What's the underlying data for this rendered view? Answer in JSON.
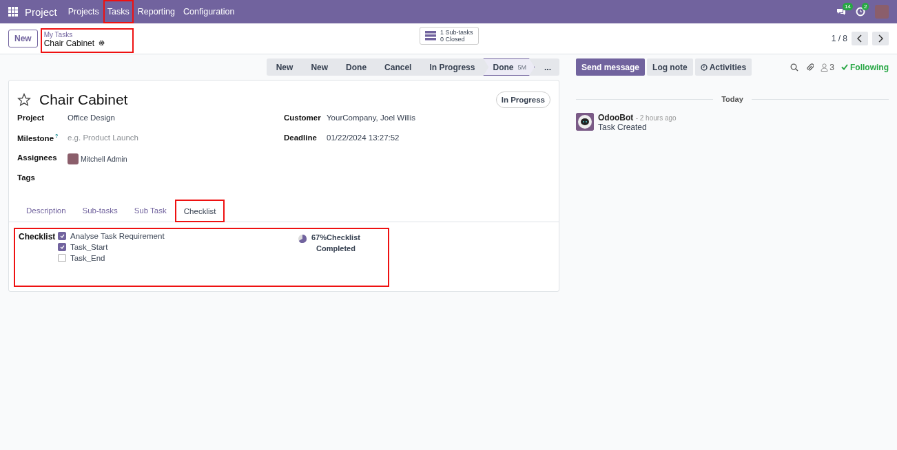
{
  "navbar": {
    "app": "Project",
    "menu": [
      {
        "label": "Projects",
        "highlighted": false
      },
      {
        "label": "Tasks",
        "highlighted": true
      },
      {
        "label": "Reporting",
        "highlighted": false
      },
      {
        "label": "Configuration",
        "highlighted": false
      }
    ],
    "messages_badge": "14",
    "activities_badge": "2"
  },
  "control_panel": {
    "new_button": "New",
    "breadcrumb": {
      "parent": "My Tasks",
      "current": "Chair Cabinet",
      "highlighted": true
    },
    "subtasks": {
      "count": "1 Sub-tasks",
      "closed": "0 Closed"
    },
    "pager": "1 / 8"
  },
  "statusbar": {
    "stages": [
      {
        "label": "New",
        "selected": false
      },
      {
        "label": "New",
        "selected": false
      },
      {
        "label": "Done",
        "selected": false
      },
      {
        "label": "Cancel",
        "selected": false
      },
      {
        "label": "In Progress",
        "selected": false
      },
      {
        "label": "Done",
        "note": "5M",
        "selected": true
      }
    ],
    "more": "..."
  },
  "form": {
    "title": "Chair Cabinet",
    "starred": false,
    "state": "In Progress",
    "left_fields": [
      {
        "label": "Project",
        "value": "Office Design"
      },
      {
        "label": "Milestone",
        "help": "?",
        "placeholder": "e.g. Product Launch"
      },
      {
        "label": "Assignees",
        "value": "Mitchell Admin",
        "kind": "avatar"
      },
      {
        "label": "Tags"
      }
    ],
    "right_fields": [
      {
        "label": "Customer",
        "value": "YourCompany, Joel Willis"
      },
      {
        "label": "Deadline",
        "value": "01/22/2024 13:27:52"
      }
    ],
    "tabs": [
      {
        "label": "Description",
        "selected": false,
        "highlighted": false
      },
      {
        "label": "Sub-tasks",
        "selected": false,
        "highlighted": false
      },
      {
        "label": "Sub Task",
        "selected": false,
        "highlighted": false
      },
      {
        "label": "Checklist",
        "selected": true,
        "highlighted": true
      }
    ],
    "checklist": {
      "label": "Checklist",
      "highlighted": true,
      "items": [
        {
          "label": "Analyse Task Requirement",
          "checked": true
        },
        {
          "label": "Task_Start",
          "checked": true
        },
        {
          "label": "Task_End",
          "checked": false
        }
      ],
      "progress": {
        "level": 0.67,
        "text": "67%Checklist",
        "subtext": "Completed"
      }
    }
  },
  "chatter": {
    "buttons": [
      {
        "label": "Send message",
        "kind": "primary"
      },
      {
        "label": "Log note",
        "kind": "secondary"
      },
      {
        "label": "Activities",
        "kind": "activities"
      }
    ],
    "followers": "3",
    "following": "Following",
    "date_separator": "Today",
    "messages": [
      {
        "author": "OdooBot",
        "time": "- 2 hours ago",
        "body": "Task Created"
      }
    ]
  }
}
